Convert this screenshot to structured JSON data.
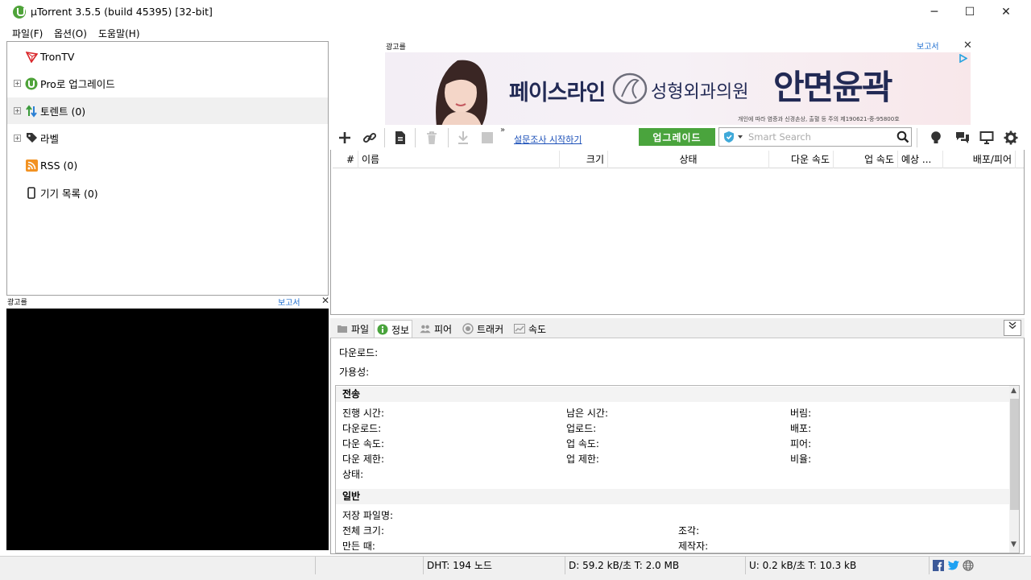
{
  "window": {
    "title": "µTorrent 3.5.5  (build 45395) [32-bit]",
    "minimize": "─",
    "maximize": "☐",
    "close": "✕"
  },
  "menu": [
    "파일(F)",
    "옵션(O)",
    "도움말(H)"
  ],
  "sidebar": {
    "items": [
      {
        "label": "TronTV",
        "icon": "trontv-icon",
        "expandable": false
      },
      {
        "label": "Pro로 업그레이드",
        "icon": "utorrent-logo-icon",
        "expandable": true
      },
      {
        "label": "토렌트 (0)",
        "icon": "torrents-updown-icon",
        "expandable": true,
        "selected": true
      },
      {
        "label": "라벨",
        "icon": "label-tag-icon",
        "expandable": true
      },
      {
        "label": "RSS (0)",
        "icon": "rss-icon",
        "expandable": false
      },
      {
        "label": "기기 목록 (0)",
        "icon": "device-icon",
        "expandable": false
      }
    ]
  },
  "ads": {
    "label": "광고를",
    "report": "보고서",
    "close": "✕",
    "top": {
      "brand": "페이스라인",
      "clinic": "성형외과의원",
      "headline": "안면윤곽",
      "fine_print": "개인에 따라 염증과 신경손상, 출혈 등 주의      제190621-중-95800호",
      "choice_icon": "adchoices-icon"
    }
  },
  "toolbar": {
    "survey_link": "설문조사 시작하기",
    "more": "»",
    "upgrade": "업그레이드",
    "search_placeholder": "Smart Search"
  },
  "torrent_list": {
    "columns": [
      "#",
      "이름",
      "크기",
      "상태",
      "다운 속도",
      "업 속도",
      "예상 ...",
      "배포/피어"
    ]
  },
  "detail_tabs": [
    {
      "label": "파일",
      "icon": "folder-icon"
    },
    {
      "label": "정보",
      "icon": "info-icon",
      "active": true
    },
    {
      "label": "피어",
      "icon": "peers-icon"
    },
    {
      "label": "트래커",
      "icon": "tracker-icon"
    },
    {
      "label": "속도",
      "icon": "speed-graph-icon"
    }
  ],
  "detail": {
    "download_label": "다운로드:",
    "availability_label": "가용성:",
    "transfer_section": "전송",
    "transfer": {
      "col1": [
        "진행 시간:",
        "다운로드:",
        "다운 속도:",
        "다운 제한:",
        "상태:"
      ],
      "col2": [
        "남은 시간:",
        "업로드:",
        "업 속도:",
        "업 제한:"
      ],
      "col3": [
        "버림:",
        "배포:",
        "피어:",
        "비율:"
      ]
    },
    "general_section": "일반",
    "general": {
      "col1": [
        "저장 파일명:",
        "전체 크기:",
        "만든 때:"
      ],
      "col2": [
        "조각:",
        "제작자:"
      ]
    }
  },
  "status": {
    "dht": "DHT: 194 노드",
    "download": "D: 59.2 kB/초 T: 2.0 MB",
    "upload": "U: 0.2 kB/초 T: 10.3 kB"
  },
  "colors": {
    "accent_green": "#4aa43d",
    "link_blue": "#1b4fb8",
    "ad_navy": "#222a55"
  }
}
